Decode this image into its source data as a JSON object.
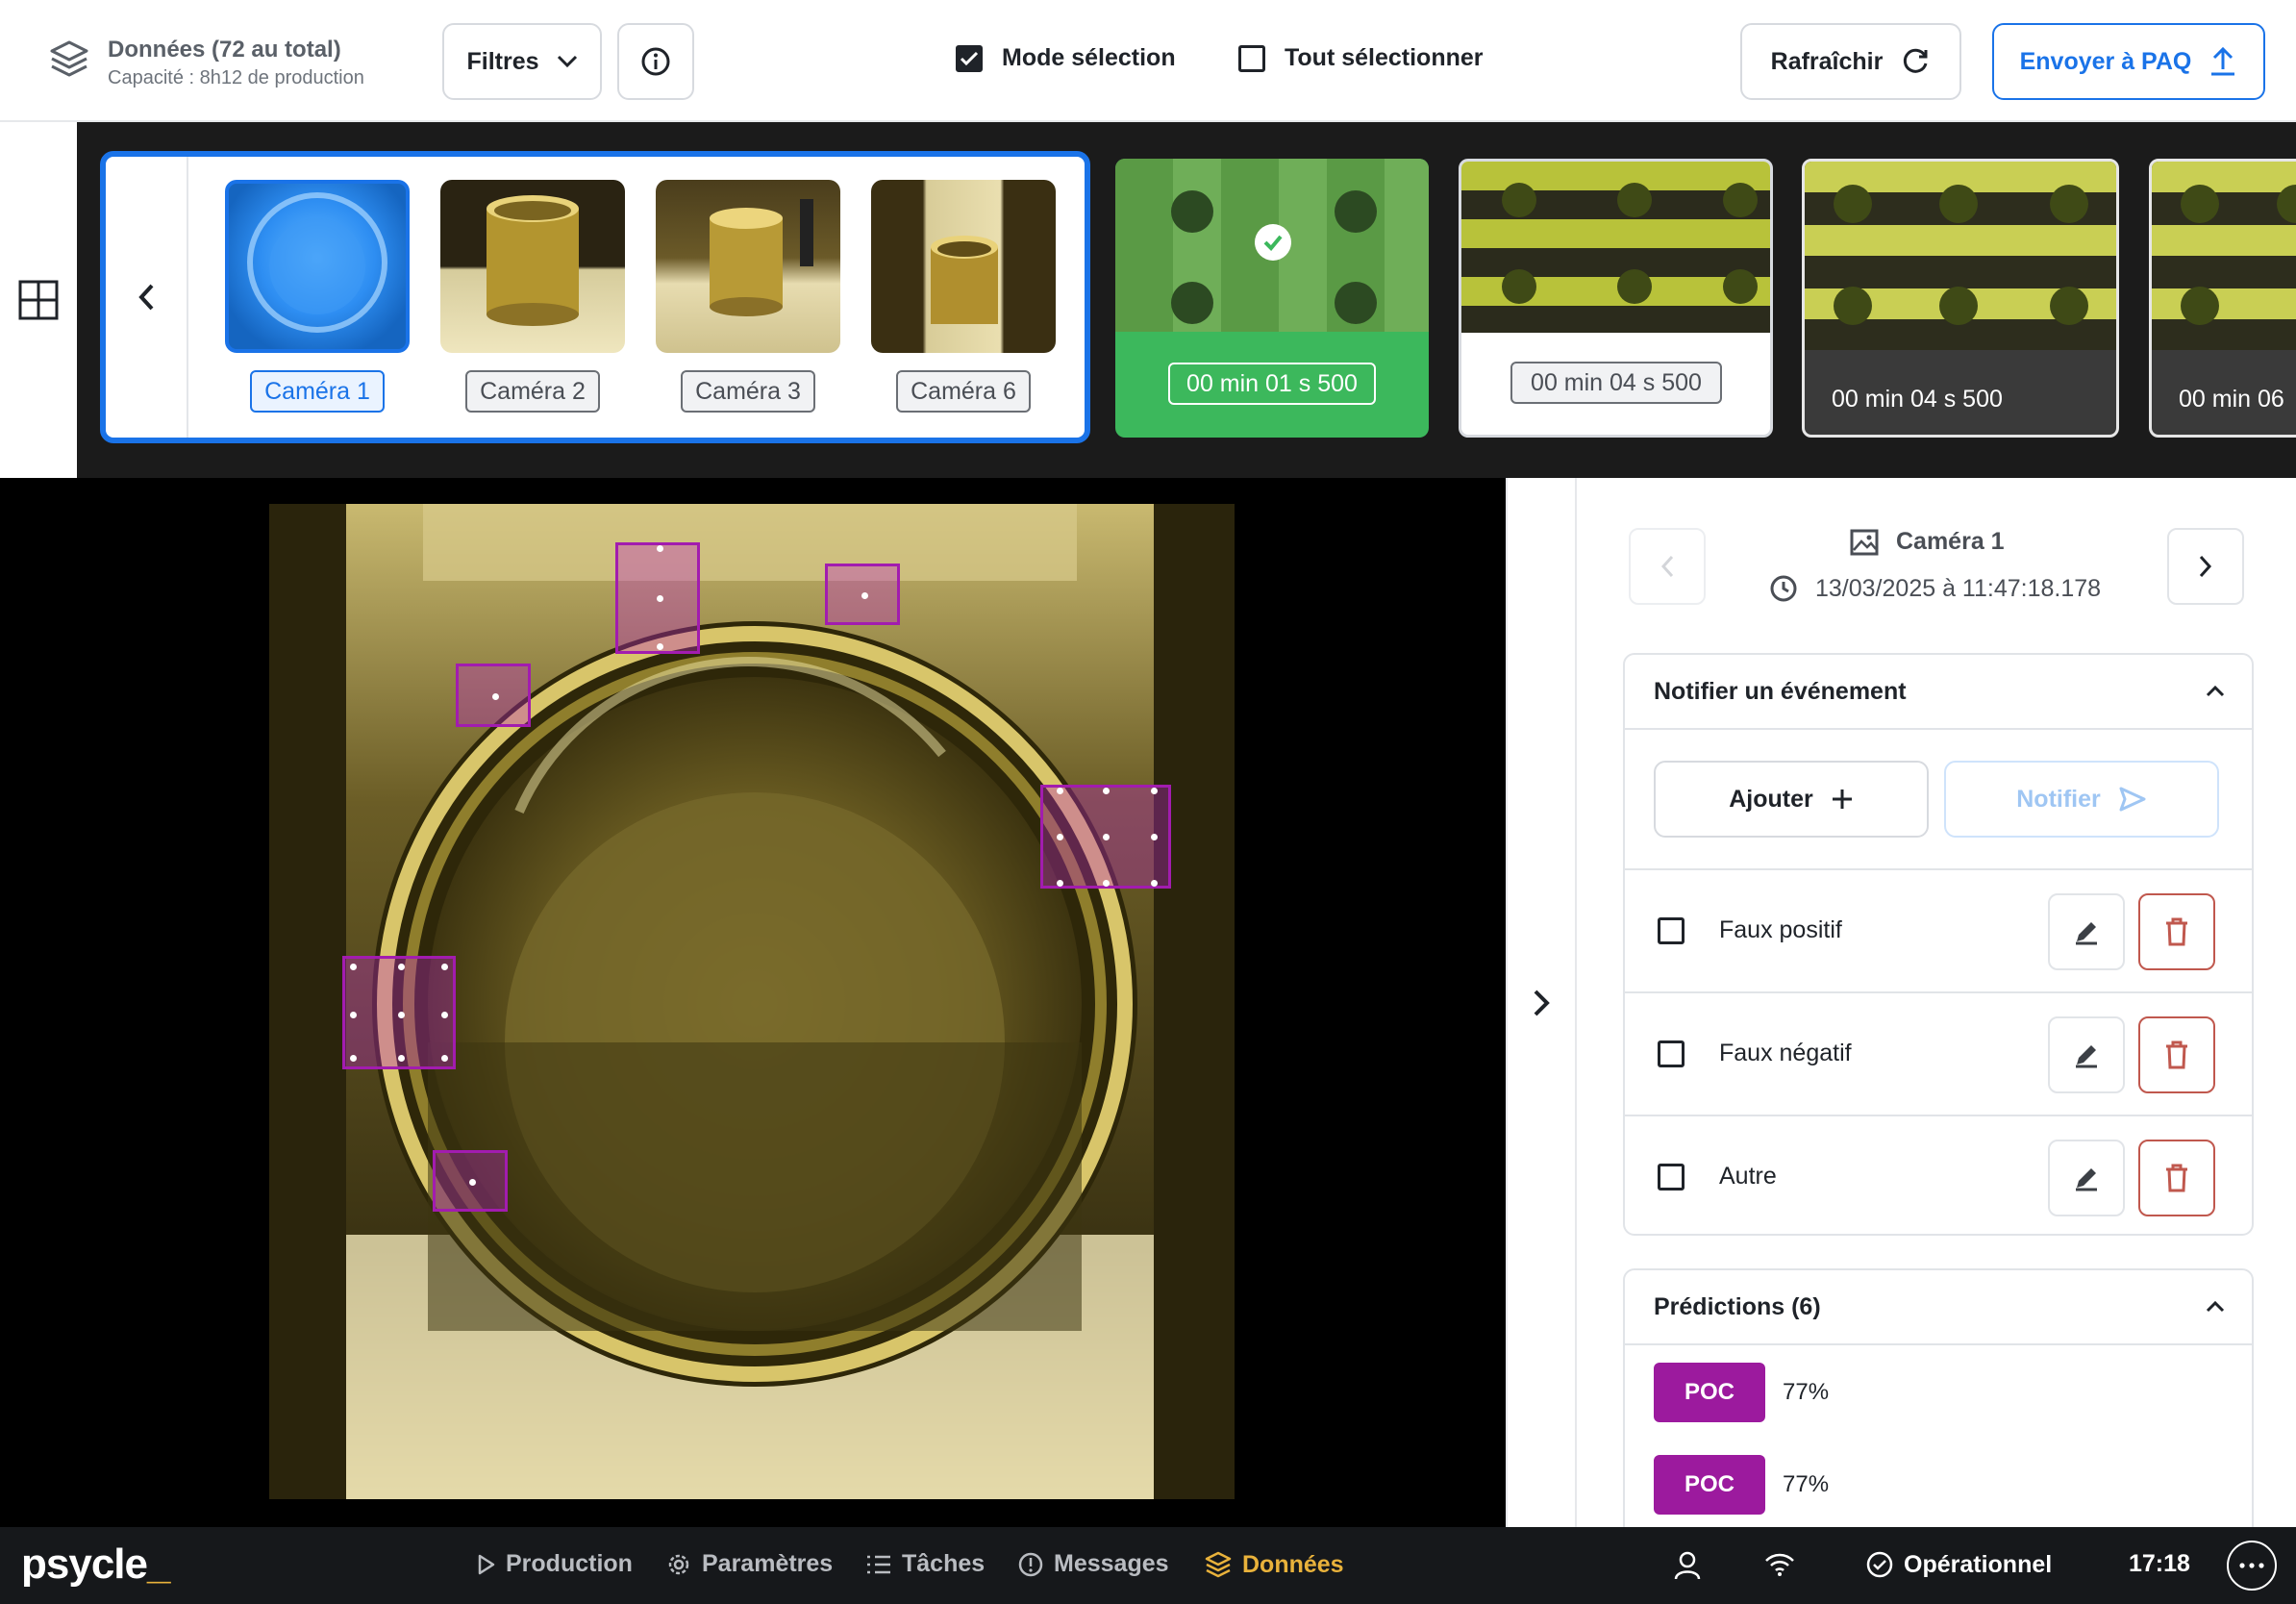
{
  "header": {
    "title": "Données (72 au total)",
    "subtitle": "Capacité : 8h12 de production",
    "filters_label": "Filtres",
    "mode_selection_label": "Mode sélection",
    "mode_selection_checked": true,
    "select_all_label": "Tout sélectionner",
    "select_all_checked": false,
    "refresh_label": "Rafraîchir",
    "send_label": "Envoyer à PAQ"
  },
  "strip": {
    "cameras": [
      {
        "label": "Caméra 1",
        "selected": true
      },
      {
        "label": "Caméra 2",
        "selected": false
      },
      {
        "label": "Caméra 3",
        "selected": false
      },
      {
        "label": "Caméra 6",
        "selected": false
      }
    ],
    "frames": [
      {
        "time": "00 min 01 s 500",
        "state": "validated"
      },
      {
        "time": "00 min 04 s 500",
        "state": "light"
      },
      {
        "time": "00 min 04 s 500",
        "state": "dark"
      },
      {
        "time": "00 min 06",
        "state": "dark"
      }
    ]
  },
  "panel": {
    "camera": "Caméra 1",
    "timestamp": "13/03/2025 à 11:47:18.178",
    "notify_title": "Notifier un événement",
    "add_label": "Ajouter",
    "notify_label": "Notifier",
    "events": [
      {
        "label": "Faux positif",
        "checked": false
      },
      {
        "label": "Faux négatif",
        "checked": false
      },
      {
        "label": "Autre",
        "checked": false
      }
    ],
    "predictions_title": "Prédictions (6)",
    "predictions": [
      {
        "label": "POC",
        "score": "77%"
      },
      {
        "label": "POC",
        "score": "77%"
      }
    ]
  },
  "bottom": {
    "logo": "psycle",
    "logo_suffix": "_",
    "nav": [
      {
        "label": "Production",
        "active": false
      },
      {
        "label": "Paramètres",
        "active": false
      },
      {
        "label": "Tâches",
        "active": false
      },
      {
        "label": "Messages",
        "active": false
      },
      {
        "label": "Données",
        "active": true
      }
    ],
    "status": "Opérationnel",
    "time": "17:18"
  },
  "colors": {
    "accent_blue": "#1a73e8",
    "validated_green": "#3cb85c",
    "prediction_purple": "#9c1a9e",
    "active_nav": "#e9b23b",
    "delete_red": "#c0584e"
  }
}
